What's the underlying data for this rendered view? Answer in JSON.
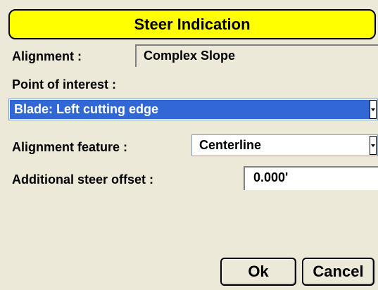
{
  "dialog": {
    "title": "Steer Indication"
  },
  "alignment": {
    "label": "Alignment :",
    "value": "Complex Slope"
  },
  "point_of_interest": {
    "label": "Point of interest :",
    "selected": "Blade: Left cutting edge"
  },
  "alignment_feature": {
    "label": "Alignment feature :",
    "selected": "Centerline"
  },
  "steer_offset": {
    "label": "Additional steer offset :",
    "value": "0.000'"
  },
  "buttons": {
    "ok": "Ok",
    "cancel": "Cancel"
  },
  "colors": {
    "title_bg": "#ffff00",
    "selection_bg": "#3168d5",
    "dialog_bg": "#ece9d8"
  }
}
